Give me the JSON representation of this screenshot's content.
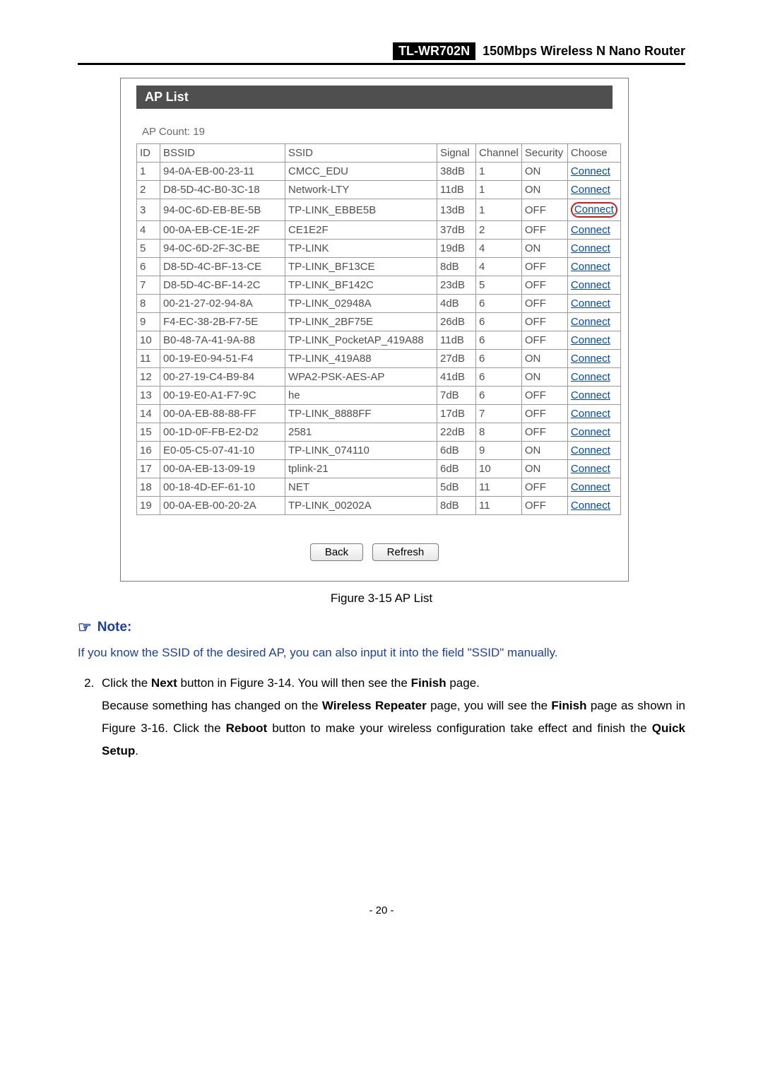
{
  "header": {
    "model": "TL-WR702N",
    "desc": "150Mbps  Wireless  N  Nano  Router"
  },
  "panel": {
    "title": "AP List",
    "count_label": "AP Count:   19",
    "columns": {
      "id": "ID",
      "bssid": "BSSID",
      "ssid": "SSID",
      "signal": "Signal",
      "channel": "Channel",
      "security": "Security",
      "choose": "Choose"
    },
    "connect_label": "Connect",
    "rows": [
      {
        "id": "1",
        "bssid": "94-0A-EB-00-23-11",
        "ssid": "CMCC_EDU",
        "sig": "38dB",
        "ch": "1",
        "sec": "ON"
      },
      {
        "id": "2",
        "bssid": "D8-5D-4C-B0-3C-18",
        "ssid": "Network-LTY",
        "sig": "11dB",
        "ch": "1",
        "sec": "ON"
      },
      {
        "id": "3",
        "bssid": "94-0C-6D-EB-BE-5B",
        "ssid": "TP-LINK_EBBE5B",
        "sig": "13dB",
        "ch": "1",
        "sec": "OFF",
        "hl": true
      },
      {
        "id": "4",
        "bssid": "00-0A-EB-CE-1E-2F",
        "ssid": "CE1E2F",
        "sig": "37dB",
        "ch": "2",
        "sec": "OFF"
      },
      {
        "id": "5",
        "bssid": "94-0C-6D-2F-3C-BE",
        "ssid": "TP-LINK",
        "sig": "19dB",
        "ch": "4",
        "sec": "ON"
      },
      {
        "id": "6",
        "bssid": "D8-5D-4C-BF-13-CE",
        "ssid": "TP-LINK_BF13CE",
        "sig": "8dB",
        "ch": "4",
        "sec": "OFF"
      },
      {
        "id": "7",
        "bssid": "D8-5D-4C-BF-14-2C",
        "ssid": "TP-LINK_BF142C",
        "sig": "23dB",
        "ch": "5",
        "sec": "OFF"
      },
      {
        "id": "8",
        "bssid": "00-21-27-02-94-8A",
        "ssid": "TP-LINK_02948A",
        "sig": "4dB",
        "ch": "6",
        "sec": "OFF"
      },
      {
        "id": "9",
        "bssid": "F4-EC-38-2B-F7-5E",
        "ssid": "TP-LINK_2BF75E",
        "sig": "26dB",
        "ch": "6",
        "sec": "OFF"
      },
      {
        "id": "10",
        "bssid": "B0-48-7A-41-9A-88",
        "ssid": "TP-LINK_PocketAP_419A88",
        "sig": "11dB",
        "ch": "6",
        "sec": "OFF"
      },
      {
        "id": "11",
        "bssid": "00-19-E0-94-51-F4",
        "ssid": "TP-LINK_419A88",
        "sig": "27dB",
        "ch": "6",
        "sec": "ON"
      },
      {
        "id": "12",
        "bssid": "00-27-19-C4-B9-84",
        "ssid": "WPA2-PSK-AES-AP",
        "sig": "41dB",
        "ch": "6",
        "sec": "ON"
      },
      {
        "id": "13",
        "bssid": "00-19-E0-A1-F7-9C",
        "ssid": "he",
        "sig": "7dB",
        "ch": "6",
        "sec": "OFF"
      },
      {
        "id": "14",
        "bssid": "00-0A-EB-88-88-FF",
        "ssid": "TP-LINK_8888FF",
        "sig": "17dB",
        "ch": "7",
        "sec": "OFF"
      },
      {
        "id": "15",
        "bssid": "00-1D-0F-FB-E2-D2",
        "ssid": "2581",
        "sig": "22dB",
        "ch": "8",
        "sec": "OFF"
      },
      {
        "id": "16",
        "bssid": "E0-05-C5-07-41-10",
        "ssid": "TP-LINK_074110",
        "sig": "6dB",
        "ch": "9",
        "sec": "ON"
      },
      {
        "id": "17",
        "bssid": "00-0A-EB-13-09-19",
        "ssid": "tplink-21",
        "sig": "6dB",
        "ch": "10",
        "sec": "ON"
      },
      {
        "id": "18",
        "bssid": "00-18-4D-EF-61-10",
        "ssid": "NET",
        "sig": "5dB",
        "ch": "11",
        "sec": "OFF"
      },
      {
        "id": "19",
        "bssid": "00-0A-EB-00-20-2A",
        "ssid": "TP-LINK_00202A",
        "sig": "8dB",
        "ch": "11",
        "sec": "OFF"
      }
    ],
    "buttons": {
      "back": "Back",
      "refresh": "Refresh"
    }
  },
  "figure_caption": "Figure 3-15 AP List",
  "note": {
    "label": "Note:",
    "body": "If you know the SSID of the desired AP, you can also input it into the field \"SSID\" manually."
  },
  "step": {
    "num": "2.",
    "line1_a": "Click the ",
    "line1_b": "Next",
    "line1_c": " button in Figure 3-14. You will then see the ",
    "line1_d": "Finish",
    "line1_e": " page.",
    "line2_a": "Because something has changed on the ",
    "line2_b": "Wireless Repeater",
    "line2_c": " page, you will see the ",
    "line2_d": "Finish",
    "line2_e": " page as shown in Figure 3-16. Click the ",
    "line2_f": "Reboot",
    "line2_g": " button to make your wireless configuration take effect and finish the ",
    "line2_h": "Quick Setup",
    "line2_i": "."
  },
  "page_number": "- 20 -"
}
